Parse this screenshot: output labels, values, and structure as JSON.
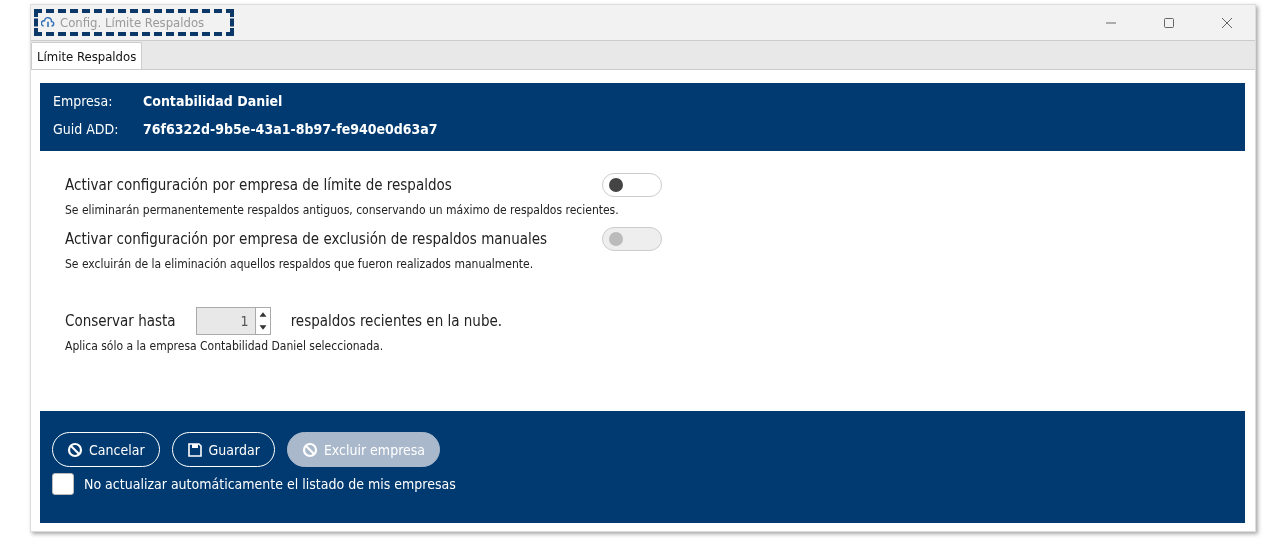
{
  "window": {
    "title": "Config. Límite Respaldos"
  },
  "tabs": [
    {
      "label": "Límite Respaldos",
      "selected": true
    }
  ],
  "header": {
    "rows": [
      {
        "label": "Empresa:",
        "value": "Contabilidad Daniel"
      },
      {
        "label": "Guid ADD:",
        "value": "76f6322d-9b5e-43a1-8b97-fe940e0d63a7"
      }
    ]
  },
  "settings": [
    {
      "label": "Activar configuración por empresa de límite de respaldos",
      "on": false,
      "disabled": false,
      "hint": "Se eliminarán permanentemente respaldos antiguos, conservando un máximo de respaldos recientes."
    },
    {
      "label": "Activar configuración por empresa de exclusión de respaldos manuales",
      "on": false,
      "disabled": true,
      "hint": "Se excluirán de la eliminación aquellos respaldos que fueron realizados manualmente."
    }
  ],
  "keep": {
    "label": "Conservar hasta",
    "value": "1",
    "suffix": "respaldos recientes en la nube.",
    "hint": "Aplica sólo a la empresa Contabilidad Daniel seleccionada."
  },
  "buttons": [
    {
      "label": "Cancelar",
      "kind": "cancel",
      "disabled": false
    },
    {
      "label": "Guardar",
      "kind": "save",
      "disabled": false
    },
    {
      "label": "Excluir empresa",
      "kind": "cancel",
      "disabled": true
    }
  ],
  "auto_update": {
    "label": "No actualizar automáticamente el listado de mis empresas",
    "checked": false
  }
}
